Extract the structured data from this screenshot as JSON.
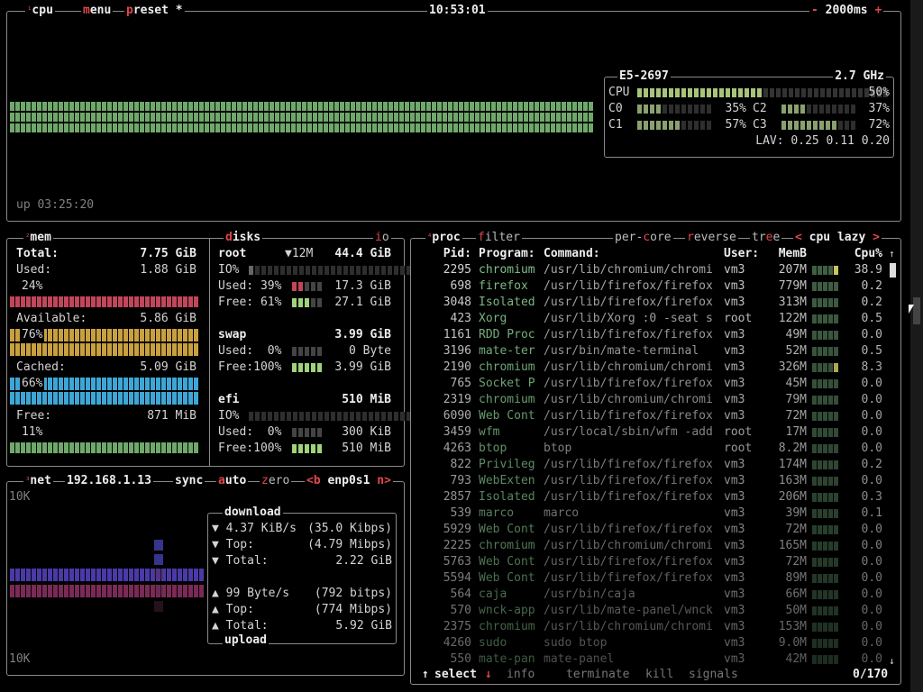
{
  "cpu_box": {
    "tag_cpu": "cpu",
    "tag_menu": "menu",
    "tag_preset": "preset *",
    "clock": "10:53:01",
    "interval": "2000ms",
    "interval_minus": "-",
    "interval_plus": "+",
    "uptime": "up 03:25:20",
    "model": "E5-2697",
    "freq": "2.7 GHz",
    "cpu_label": "CPU",
    "cpu_total": "50%",
    "cpu_total_frac": 0.5,
    "cores": [
      {
        "name": "C0",
        "pct": "35%",
        "frac": 0.35
      },
      {
        "name": "C2",
        "pct": "37%",
        "frac": 0.37
      },
      {
        "name": "C1",
        "pct": "57%",
        "frac": 0.57
      },
      {
        "name": "C3",
        "pct": "72%",
        "frac": 0.72
      }
    ],
    "lav_label": "LAV:",
    "lav": "0.25 0.11 0.20"
  },
  "mem_box": {
    "tag": "mem",
    "total_label": "Total:",
    "total": "7.75 GiB",
    "used_label": "Used:",
    "used": "1.88 GiB",
    "used_pct": "24%",
    "avail_label": "Available:",
    "avail": "5.86 GiB",
    "avail_pct": "76%",
    "cached_label": "Cached:",
    "cached": "5.09 GiB",
    "cached_pct": "66%",
    "free_label": "Free:",
    "free": "871 MiB",
    "free_pct": "11%"
  },
  "disks_box": {
    "tag": "disks",
    "io_tag": "io",
    "root": {
      "name": "root",
      "io_speed": "▼12M",
      "size": "44.4 GiB",
      "io_label": "IO%",
      "used_label": "Used: 39%",
      "used": "17.3 GiB",
      "free_label": "Free: 61%",
      "free": "27.1 GiB"
    },
    "swap": {
      "name": "swap",
      "size": "3.99 GiB",
      "used_label": "Used:  0%",
      "used": "0 Byte",
      "free_label": "Free:100%",
      "free": "3.99 GiB"
    },
    "efi": {
      "name": "efi",
      "size": "510 MiB",
      "io_label": "IO%",
      "used_label": "Used:  0%",
      "used": "300 KiB",
      "free_label": "Free:100%",
      "free": "510 MiB"
    }
  },
  "net_box": {
    "tag": "net",
    "ip": "192.168.1.13",
    "sync": "sync",
    "auto": "auto",
    "zero": "zero",
    "prev": "<b",
    "iface": "enp0s1",
    "next": "n>",
    "scale_top": "10K",
    "scale_bottom": "10K",
    "download_title": "download",
    "upload_title": "upload",
    "dl_rate": "4.37 KiB/s",
    "dl_rate_bits": "(35.0 Kibps)",
    "dl_top_label": "Top:",
    "dl_top": "(4.79 Mibps)",
    "dl_total_label": "Total:",
    "dl_total": "2.22 GiB",
    "ul_rate": "99 Byte/s",
    "ul_rate_bits": "(792 bitps)",
    "ul_top_label": "Top:",
    "ul_top": "(774 Mibps)",
    "ul_total_label": "Total:",
    "ul_total": "5.92 GiB",
    "down_arrow": "▼",
    "up_arrow": "▲"
  },
  "proc_box": {
    "tag": "proc",
    "filter": "filter",
    "per_core": "per-core",
    "reverse": "reverse",
    "tree": "tree",
    "sort_prev": "<",
    "sort": "cpu lazy",
    "sort_next": ">",
    "headers": {
      "pid": "Pid:",
      "program": "Program:",
      "command": "Command:",
      "user": "User:",
      "mem": "MemB",
      "cpu": "Cpu%"
    },
    "rows": [
      {
        "pid": "2295",
        "program": "chromium",
        "command": "/usr/lib/chromium/chromi",
        "user": "vm3",
        "mem": "207M",
        "cpu": "38.9"
      },
      {
        "pid": "698",
        "program": "firefox",
        "command": "/usr/lib/firefox/firefox",
        "user": "vm3",
        "mem": "779M",
        "cpu": "0.2"
      },
      {
        "pid": "3048",
        "program": "Isolated",
        "command": "/usr/lib/firefox/firefox",
        "user": "vm3",
        "mem": "313M",
        "cpu": "0.2"
      },
      {
        "pid": "423",
        "program": "Xorg",
        "command": "/usr/lib/Xorg :0 -seat s",
        "user": "root",
        "mem": "122M",
        "cpu": "0.5"
      },
      {
        "pid": "1161",
        "program": "RDD Proc",
        "command": "/usr/lib/firefox/firefox",
        "user": "vm3",
        "mem": "49M",
        "cpu": "0.0"
      },
      {
        "pid": "3196",
        "program": "mate-ter",
        "command": "/usr/bin/mate-terminal",
        "user": "vm3",
        "mem": "52M",
        "cpu": "0.5"
      },
      {
        "pid": "2190",
        "program": "chromium",
        "command": "/usr/lib/chromium/chromi",
        "user": "vm3",
        "mem": "326M",
        "cpu": "8.3"
      },
      {
        "pid": "765",
        "program": "Socket P",
        "command": "/usr/lib/firefox/firefox",
        "user": "vm3",
        "mem": "45M",
        "cpu": "0.0"
      },
      {
        "pid": "2319",
        "program": "chromium",
        "command": "/usr/lib/chromium/chromi",
        "user": "vm3",
        "mem": "79M",
        "cpu": "0.0"
      },
      {
        "pid": "6090",
        "program": "Web Cont",
        "command": "/usr/lib/firefox/firefox",
        "user": "vm3",
        "mem": "72M",
        "cpu": "0.0"
      },
      {
        "pid": "3459",
        "program": "wfm",
        "command": "/usr/local/sbin/wfm -add",
        "user": "root",
        "mem": "17M",
        "cpu": "0.0"
      },
      {
        "pid": "4263",
        "program": "btop",
        "command": "btop",
        "user": "root",
        "mem": "8.2M",
        "cpu": "0.0"
      },
      {
        "pid": "822",
        "program": "Privileg",
        "command": "/usr/lib/firefox/firefox",
        "user": "vm3",
        "mem": "174M",
        "cpu": "0.2"
      },
      {
        "pid": "793",
        "program": "WebExten",
        "command": "/usr/lib/firefox/firefox",
        "user": "vm3",
        "mem": "163M",
        "cpu": "0.0"
      },
      {
        "pid": "2857",
        "program": "Isolated",
        "command": "/usr/lib/firefox/firefox",
        "user": "vm3",
        "mem": "206M",
        "cpu": "0.3"
      },
      {
        "pid": "539",
        "program": "marco",
        "command": "marco",
        "user": "vm3",
        "mem": "39M",
        "cpu": "0.1"
      },
      {
        "pid": "5929",
        "program": "Web Cont",
        "command": "/usr/lib/firefox/firefox",
        "user": "vm3",
        "mem": "72M",
        "cpu": "0.0"
      },
      {
        "pid": "2225",
        "program": "chromium",
        "command": "/usr/lib/chromium/chromi",
        "user": "vm3",
        "mem": "165M",
        "cpu": "0.0"
      },
      {
        "pid": "5763",
        "program": "Web Cont",
        "command": "/usr/lib/firefox/firefox",
        "user": "vm3",
        "mem": "72M",
        "cpu": "0.0"
      },
      {
        "pid": "5594",
        "program": "Web Cont",
        "command": "/usr/lib/firefox/firefox",
        "user": "vm3",
        "mem": "89M",
        "cpu": "0.0"
      },
      {
        "pid": "564",
        "program": "caja",
        "command": "/usr/bin/caja",
        "user": "vm3",
        "mem": "66M",
        "cpu": "0.0"
      },
      {
        "pid": "570",
        "program": "wnck-app",
        "command": "/usr/lib/mate-panel/wnck",
        "user": "vm3",
        "mem": "50M",
        "cpu": "0.0"
      },
      {
        "pid": "2375",
        "program": "chromium",
        "command": "/usr/lib/chromium/chromi",
        "user": "vm3",
        "mem": "153M",
        "cpu": "0.0"
      },
      {
        "pid": "4260",
        "program": "sudo",
        "command": "sudo btop",
        "user": "vm3",
        "mem": "9.0M",
        "cpu": "0.0"
      },
      {
        "pid": "550",
        "program": "mate-pan",
        "command": "mate-panel",
        "user": "vm3",
        "mem": "42M",
        "cpu": "0.0"
      }
    ],
    "footer": {
      "select": "select",
      "info": "info",
      "terminate": "terminate",
      "kill": "kill",
      "signals": "signals",
      "count": "0/170"
    }
  },
  "colors": {
    "border": "#8a8a8a",
    "hotkey": "#e0474c",
    "cpu_graph": "#6fa86a",
    "mem_used": "#c2465a",
    "mem_avail": "#c9a040",
    "mem_cached": "#3ea6d6",
    "mem_free": "#6fa86a",
    "net_up": "#7a2a55",
    "net_down": "#4a3aa8",
    "program": "#7fbf88",
    "command": "#a8a8a8"
  }
}
